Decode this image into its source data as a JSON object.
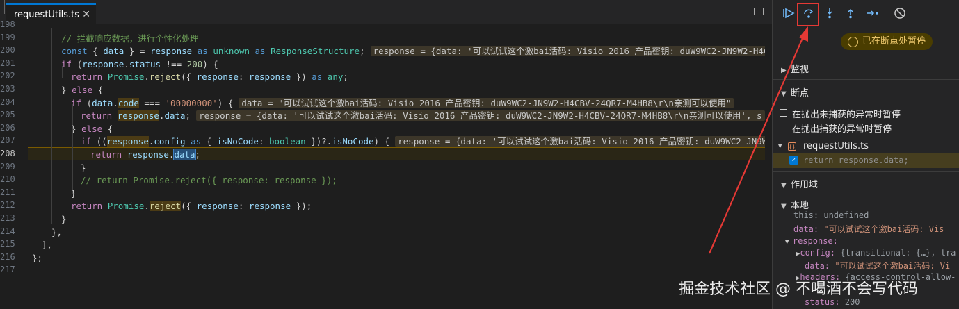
{
  "tab": {
    "label": "requestUtils.ts",
    "close": "✕"
  },
  "gutter": [
    "198",
    "199",
    "200",
    "201",
    "202",
    "203",
    "204",
    "205",
    "206",
    "207",
    "208",
    "209",
    "210",
    "211",
    "212",
    "213",
    "214",
    "215",
    "216",
    "217"
  ],
  "code_lines": {
    "l199": "// 拦截响应数据，进行个性化处理",
    "l200_inline": "response = {data: '可以试试这个激bai活码: Visio 2016 产品密钥: duW9WC2-JN9W2-H4C",
    "l204_str": "'00000000'",
    "l204_inline": "data = \"可以试试这个激bai活码: Visio 2016 产品密钥: duW9WC2-JN9W2-H4CBV-24QR7-M4HB8\\r\\n亲测可以使用\"",
    "l205_inline": "response = {data: '可以试试这个激bai活码: Visio 2016 产品密钥: duW9WC2-JN9W2-H4CBV-24QR7-M4HB8\\r\\n亲测可以使用', s",
    "l207_inline": "response = {data: '可以试试这个激bai活码: Visio 2016 产品密钥: duW9WC2-JN9W2",
    "l209_comment": "// return Promise.reject({ response: response });"
  },
  "debug": {
    "paused_label": "已在断点处暂停",
    "sections": {
      "watch": "监视",
      "breakpoints": "断点",
      "scope": "作用域",
      "local": "本地"
    },
    "exceptions": [
      "在抛出未捕获的异常时暂停",
      "在抛出捕获的异常时暂停"
    ],
    "bp_file": "requestUtils.ts",
    "bp_code": "return response.data;",
    "scope_rows": {
      "this_key": "this:",
      "this_val": "undefined",
      "data_key": "data:",
      "data_val": "\"可以试试这个激bai活码: Vis",
      "response_key": "response:",
      "config_key": "config:",
      "config_val": "{transitional: {…}, tra",
      "rdata_key": "data:",
      "rdata_val": "\"可以试试这个激bai活码: Vi",
      "headers_key": "headers:",
      "headers_val": "{access-control-allow-",
      "status_key": "status:",
      "status_val": "200"
    }
  },
  "toolbar_icons": [
    "continue-icon",
    "step-over-icon",
    "step-into-icon",
    "step-out-icon",
    "run-to-cursor-icon",
    "disable-breakpoints-icon"
  ],
  "colors": {
    "accent": "#0078d4",
    "annotation": "#e53935",
    "paused_badge": "#4a3d00"
  },
  "watermark": "掘金技术社区 @ 不喝酒不会写代码"
}
